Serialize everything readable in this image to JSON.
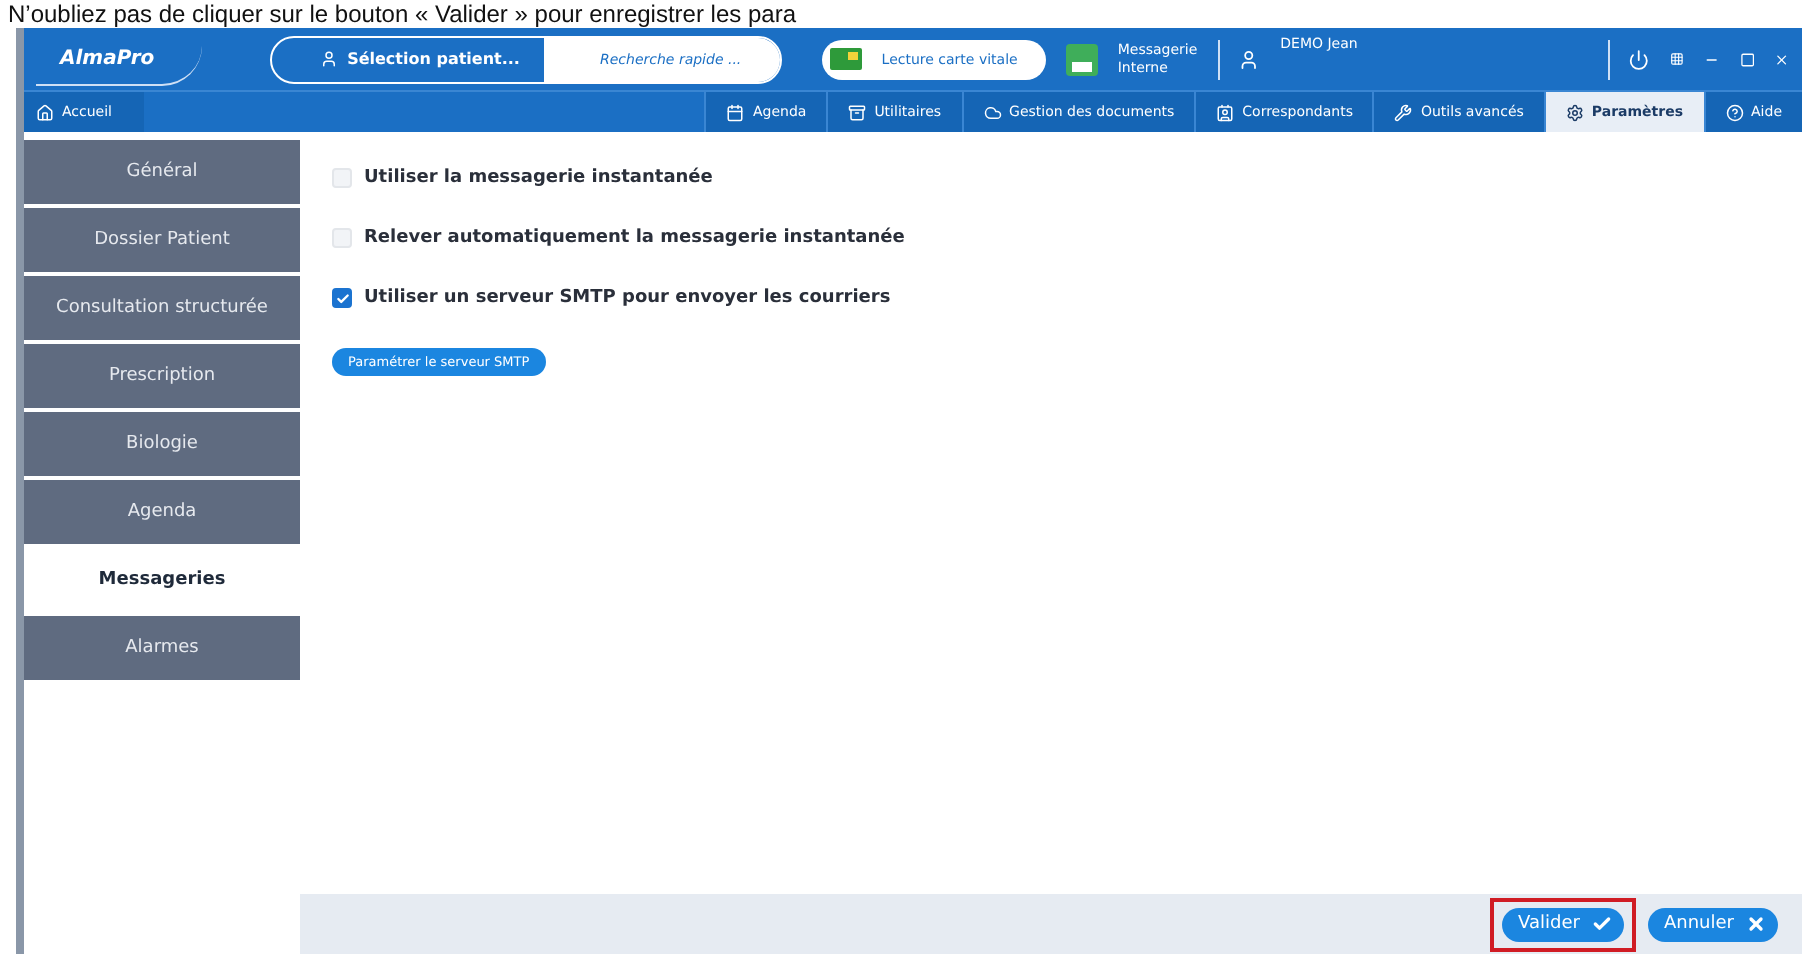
{
  "caption": "N’oubliez pas de cliquer sur le bouton « Valider » pour enregistrer les para",
  "header": {
    "logo": "AlmaPro",
    "patient_button": "Sélection patient...",
    "search": {
      "placeholder": "Recherche rapide ..."
    },
    "card_button": "Lecture carte vitale",
    "messaging": "Messagerie Interne",
    "user": "DEMO Jean"
  },
  "home_tab": "Accueil",
  "tabs": [
    {
      "label": "Agenda",
      "selected": false
    },
    {
      "label": "Utilitaires",
      "selected": false
    },
    {
      "label": "Gestion des documents",
      "selected": false
    },
    {
      "label": "Correspondants",
      "selected": false
    },
    {
      "label": "Outils avancés",
      "selected": false
    },
    {
      "label": "Paramètres",
      "selected": true
    },
    {
      "label": "Aide",
      "selected": false
    }
  ],
  "sidebar": {
    "items": [
      {
        "label": "Général",
        "selected": false
      },
      {
        "label": "Dossier Patient",
        "selected": false
      },
      {
        "label": "Consultation structurée",
        "selected": false
      },
      {
        "label": "Prescription",
        "selected": false
      },
      {
        "label": "Biologie",
        "selected": false
      },
      {
        "label": "Agenda",
        "selected": false
      },
      {
        "label": "Messageries",
        "selected": true
      },
      {
        "label": "Alarmes",
        "selected": false
      }
    ]
  },
  "options": [
    {
      "label": "Utiliser la messagerie instantanée",
      "checked": false
    },
    {
      "label": "Relever automatiquement la messagerie instantanée",
      "checked": false
    },
    {
      "label": "Utiliser un serveur SMTP pour envoyer les courriers",
      "checked": true
    }
  ],
  "smtp_button": "Paramétrer le serveur SMTP",
  "footer": {
    "validate": "Valider",
    "cancel": "Annuler"
  }
}
